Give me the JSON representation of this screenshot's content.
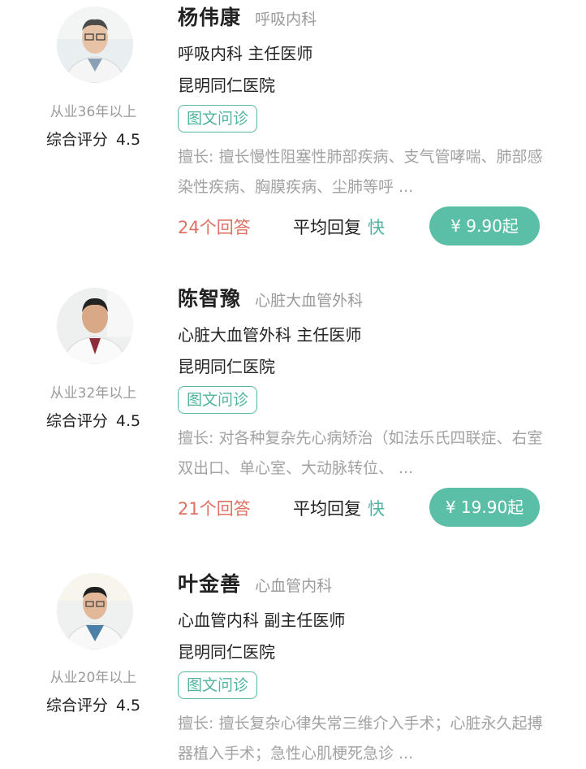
{
  "doctors": [
    {
      "name": "杨伟康",
      "dept_tag": "呼吸内科",
      "title": "呼吸内科 主任医师",
      "hospital": "昆明同仁医院",
      "years": "从业36年以上",
      "rating_label": "综合评分",
      "rating": "4.5",
      "service": "图文问诊",
      "specialty": "擅长: 擅长慢性阻塞性肺部疾病、支气管哮喘、肺部感染性疾病、胸膜疾病、尘肺等呼 ...",
      "answers": "24个回答",
      "reply_label": "平均回复",
      "reply_speed": "快",
      "price": "¥ 9.90起"
    },
    {
      "name": "陈智豫",
      "dept_tag": "心脏大血管外科",
      "title": "心脏大血管外科 主任医师",
      "hospital": "昆明同仁医院",
      "years": "从业32年以上",
      "rating_label": "综合评分",
      "rating": "4.5",
      "service": "图文问诊",
      "specialty": "擅长: 对各种复杂先心病矫治（如法乐氏四联症、右室双出口、单心室、大动脉转位、 ...",
      "answers": "21个回答",
      "reply_label": "平均回复",
      "reply_speed": "快",
      "price": "¥ 19.90起"
    },
    {
      "name": "叶金善",
      "dept_tag": "心血管内科",
      "title": "心血管内科 副主任医师",
      "hospital": "昆明同仁医院",
      "years": "从业20年以上",
      "rating_label": "综合评分",
      "rating": "4.5",
      "service": "图文问诊",
      "specialty": "擅长: 擅长复杂心律失常三维介入手术；心脏永久起搏器植入手术；急性心肌梗死急诊 ..."
    }
  ],
  "colors": {
    "accent": "#5bbfa7",
    "answers": "#e07063",
    "muted": "#9a9a9a",
    "text": "#222222"
  }
}
